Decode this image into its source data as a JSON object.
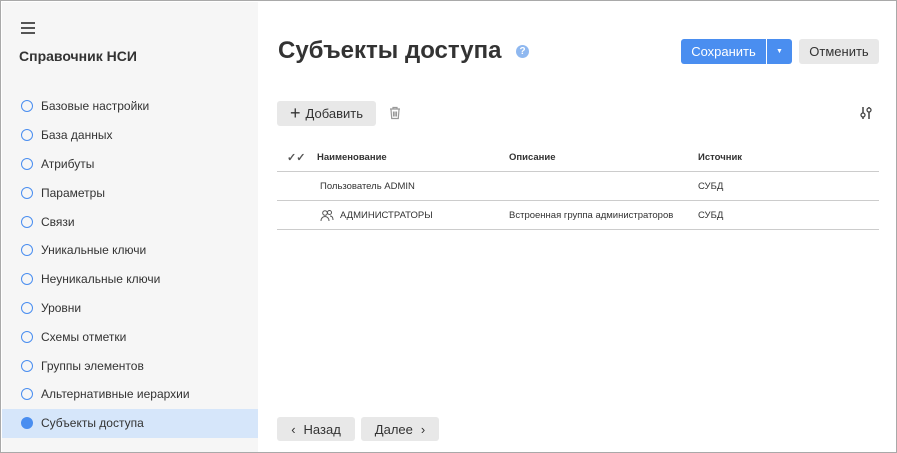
{
  "sidebar": {
    "title": "Справочник НСИ",
    "items": [
      {
        "label": "Базовые настройки"
      },
      {
        "label": "База данных"
      },
      {
        "label": "Атрибуты"
      },
      {
        "label": "Параметры"
      },
      {
        "label": "Связи"
      },
      {
        "label": "Уникальные ключи"
      },
      {
        "label": "Неуникальные ключи"
      },
      {
        "label": "Уровни"
      },
      {
        "label": "Схемы отметки"
      },
      {
        "label": "Группы элементов"
      },
      {
        "label": "Альтернативные иерархии"
      },
      {
        "label": "Субъекты доступа"
      }
    ],
    "active_index": 11
  },
  "header": {
    "title": "Субъекты доступа",
    "help": "?",
    "save": "Сохранить",
    "cancel": "Отменить"
  },
  "toolbar": {
    "add": "Добавить"
  },
  "table": {
    "columns": [
      "Наименование",
      "Описание",
      "Источник"
    ],
    "rows": [
      {
        "name": "Пользователь ADMIN",
        "description": "",
        "source": "СУБД",
        "icon": "none"
      },
      {
        "name": "АДМИНИСТРАТОРЫ",
        "description": "Встроенная группа администраторов",
        "source": "СУБД",
        "icon": "group-icon"
      }
    ]
  },
  "footer": {
    "back": "Назад",
    "next": "Далее"
  },
  "colors": {
    "accent": "#4a8ef0",
    "active_bg": "#d6e6fa"
  }
}
